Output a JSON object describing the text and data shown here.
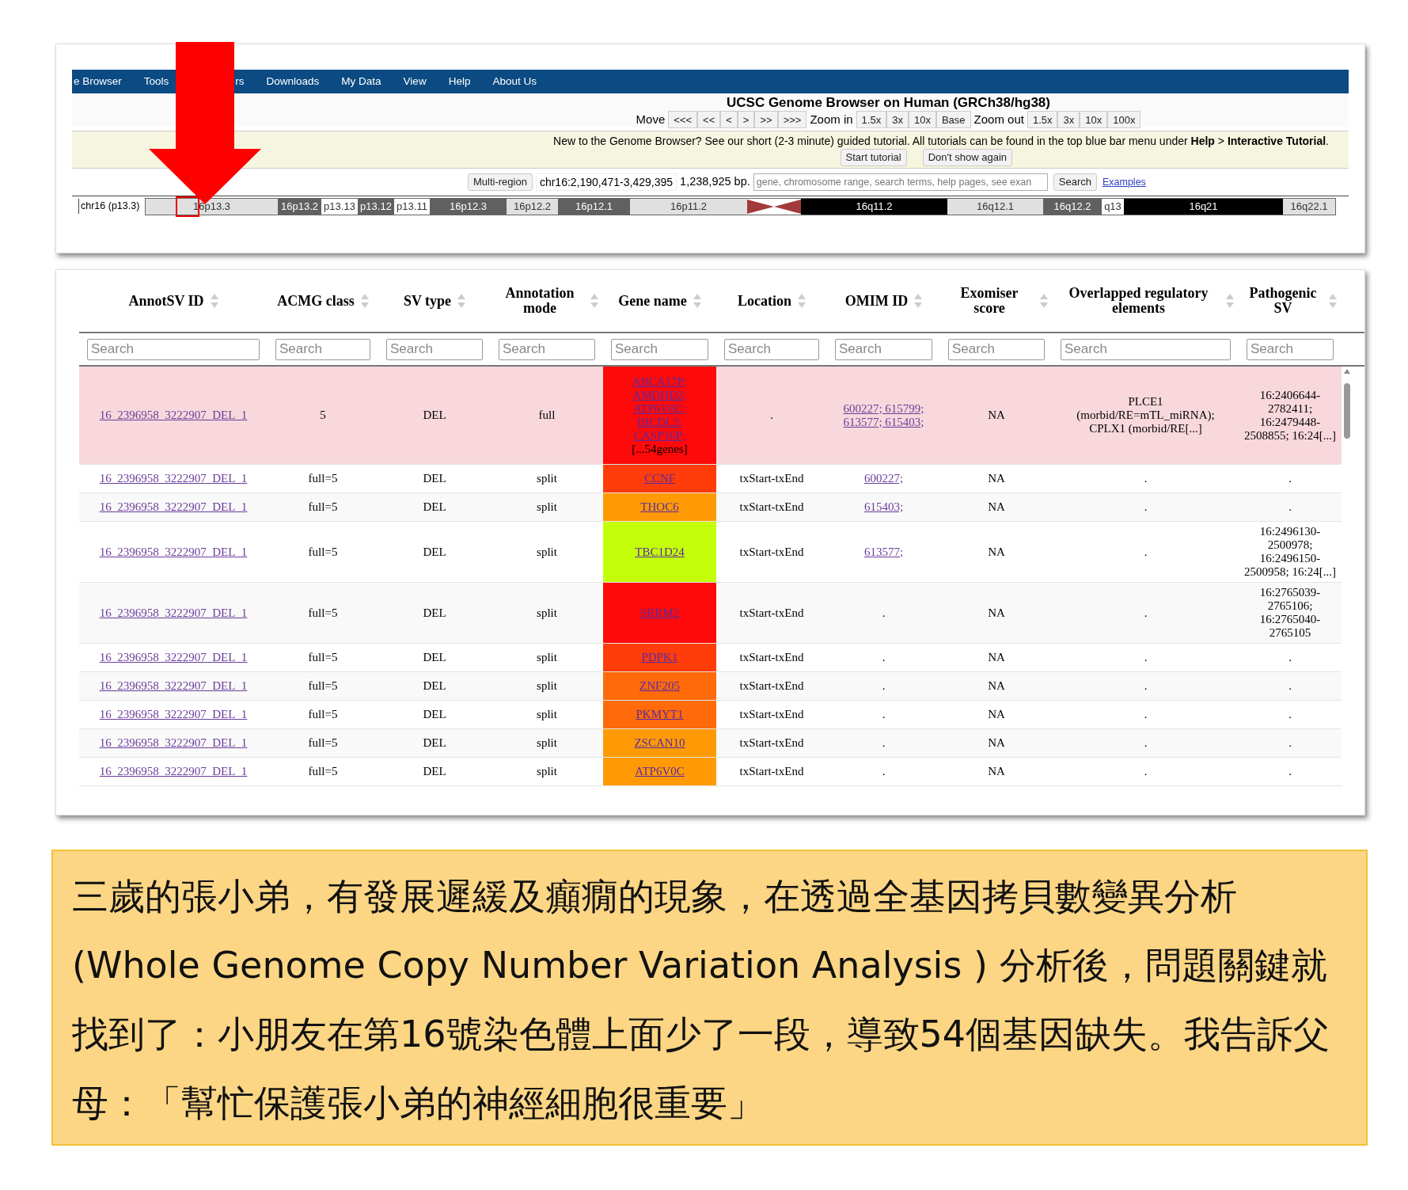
{
  "browser": {
    "nav": [
      "e Browser",
      "Tools",
      "rs",
      "Downloads",
      "My Data",
      "View",
      "Help",
      "About Us"
    ],
    "title": "UCSC Genome Browser on Human (GRCh38/hg38)",
    "move_label": "Move",
    "move_buttons": [
      "<<<",
      "<<",
      "<",
      ">",
      ">>",
      ">>>"
    ],
    "zoom_in_label": "Zoom in",
    "zoom_in_buttons": [
      "1.5x",
      "3x",
      "10x",
      "Base"
    ],
    "zoom_out_label": "Zoom out",
    "zoom_out_buttons": [
      "1.5x",
      "3x",
      "10x",
      "100x"
    ],
    "tutorial_notice": "New to the Genome Browser? See our short (2-3 minute) guided tutorial. All tutorials can be found in the top blue bar menu under **Help** > **Interactive Tutorial**.",
    "tutorial_buttons": [
      "Start tutorial",
      "Don't show again"
    ],
    "multi_region": "Multi-region",
    "position": "chr16:2,190,471-3,429,395",
    "span": "1,238,925 bp.",
    "search": {
      "placeholder": "gene, chromosome range, search terms, help pages, see exan"
    },
    "search_button": "Search",
    "examples_link": "Examples",
    "chromosome_label": "chr16 (p13.3)",
    "bands": [
      {
        "label": "16p13.3",
        "kind": "light",
        "selected": true
      },
      {
        "label": "16p13.2",
        "kind": "dark",
        "selected": false
      },
      {
        "label": "p13.13",
        "kind": "white",
        "selected": false
      },
      {
        "label": "p13.12",
        "kind": "dark",
        "selected": false
      },
      {
        "label": "p13.11",
        "kind": "white",
        "selected": false
      },
      {
        "label": "16p12.3",
        "kind": "dark",
        "selected": false
      },
      {
        "label": "16p12.2",
        "kind": "light",
        "selected": false
      },
      {
        "label": "16p12.1",
        "kind": "dark",
        "selected": false
      },
      {
        "label": "16p11.2",
        "kind": "light",
        "selected": false
      },
      {
        "kind": "centromere",
        "selected": false
      },
      {
        "label": "16q11.2",
        "kind": "black",
        "selected": false
      },
      {
        "label": "16q12.1",
        "kind": "light",
        "selected": false
      },
      {
        "label": "16q12.2",
        "kind": "dark",
        "selected": false
      },
      {
        "label": "q13",
        "kind": "white",
        "selected": false
      },
      {
        "label": "16q21",
        "kind": "black",
        "selected": false
      },
      {
        "label": "16q22.1",
        "kind": "light",
        "selected": false
      }
    ]
  },
  "table": {
    "columns": [
      {
        "label": "AnnotSV ID",
        "filter_placeholder": "Search"
      },
      {
        "label": "ACMG class",
        "filter_placeholder": "Search"
      },
      {
        "label": "SV type",
        "filter_placeholder": "Search"
      },
      {
        "label": "Annotation mode",
        "filter_placeholder": "Search"
      },
      {
        "label": "Gene name",
        "filter_placeholder": "Search"
      },
      {
        "label": "Location",
        "filter_placeholder": "Search"
      },
      {
        "label": "OMIM ID",
        "filter_placeholder": "Search"
      },
      {
        "label": "Exomiser score",
        "filter_placeholder": "Search"
      },
      {
        "label": "Overlapped regulatory elements",
        "filter_placeholder": "Search"
      },
      {
        "label": "Pathogenic SV",
        "filter_placeholder": "Search"
      }
    ],
    "rows": [
      {
        "selected": true,
        "annotsv_id": "16_2396958_3222907_DEL_1",
        "acmg_class": "5",
        "sv_type": "DEL",
        "annotation_mode": "full",
        "genes": [
          "ABCA17P;",
          "AMDHD2;",
          "ATP6V0C;",
          "BICDL2;",
          "CASP16P;"
        ],
        "gene_note": "[...54genes]",
        "color": "#fe0a0a",
        "location": ".",
        "omim": "600227; 615799; 613577; 615403;",
        "omim_linked": true,
        "exomiser": "NA",
        "regulatory": "PLCE1 (morbid/RE=mTL_miRNA); CPLX1 (morbid/RE[...]",
        "pathogenic_sv": "16:2406644-2782411; 16:2479448-2508855; 16:24[...]"
      },
      {
        "selected": false,
        "annotsv_id": "16_2396958_3222907_DEL_1",
        "acmg_class": "full=5",
        "sv_type": "DEL",
        "annotation_mode": "split",
        "genes": [
          "CCNF"
        ],
        "color": "#ff3c0a",
        "location": "txStart-txEnd",
        "omim": "600227;",
        "omim_linked": true,
        "exomiser": "NA",
        "regulatory": ".",
        "pathogenic_sv": "."
      },
      {
        "selected": false,
        "annotsv_id": "16_2396958_3222907_DEL_1",
        "acmg_class": "full=5",
        "sv_type": "DEL",
        "annotation_mode": "split",
        "genes": [
          "THOC6"
        ],
        "color": "#ff9a05",
        "location": "txStart-txEnd",
        "omim": "615403;",
        "omim_linked": true,
        "exomiser": "NA",
        "regulatory": ".",
        "pathogenic_sv": "."
      },
      {
        "selected": false,
        "annotsv_id": "16_2396958_3222907_DEL_1",
        "acmg_class": "full=5",
        "sv_type": "DEL",
        "annotation_mode": "split",
        "genes": [
          "TBC1D24"
        ],
        "color": "#c4ff0a",
        "location": "txStart-txEnd",
        "omim": "613577;",
        "omim_linked": true,
        "exomiser": "NA",
        "regulatory": ".",
        "pathogenic_sv": "16:2496130-2500978; 16:2496150-2500958; 16:24[...]"
      },
      {
        "selected": false,
        "annotsv_id": "16_2396958_3222907_DEL_1",
        "acmg_class": "full=5",
        "sv_type": "DEL",
        "annotation_mode": "split",
        "genes": [
          "SRRM2"
        ],
        "color": "#fe0a0a",
        "location": "txStart-txEnd",
        "omim": ".",
        "omim_linked": false,
        "exomiser": "NA",
        "regulatory": ".",
        "pathogenic_sv": "16:2765039-2765106; 16:2765040-2765105"
      },
      {
        "selected": false,
        "annotsv_id": "16_2396958_3222907_DEL_1",
        "acmg_class": "full=5",
        "sv_type": "DEL",
        "annotation_mode": "split",
        "genes": [
          "PDPK1"
        ],
        "color": "#ff3c0a",
        "location": "txStart-txEnd",
        "omim": ".",
        "omim_linked": false,
        "exomiser": "NA",
        "regulatory": ".",
        "pathogenic_sv": "."
      },
      {
        "selected": false,
        "annotsv_id": "16_2396958_3222907_DEL_1",
        "acmg_class": "full=5",
        "sv_type": "DEL",
        "annotation_mode": "split",
        "genes": [
          "ZNF205"
        ],
        "color": "#ff6a0a",
        "location": "txStart-txEnd",
        "omim": ".",
        "omim_linked": false,
        "exomiser": "NA",
        "regulatory": ".",
        "pathogenic_sv": "."
      },
      {
        "selected": false,
        "annotsv_id": "16_2396958_3222907_DEL_1",
        "acmg_class": "full=5",
        "sv_type": "DEL",
        "annotation_mode": "split",
        "genes": [
          "PKMYT1"
        ],
        "color": "#ff6a0a",
        "location": "txStart-txEnd",
        "omim": ".",
        "omim_linked": false,
        "exomiser": "NA",
        "regulatory": ".",
        "pathogenic_sv": "."
      },
      {
        "selected": false,
        "annotsv_id": "16_2396958_3222907_DEL_1",
        "acmg_class": "full=5",
        "sv_type": "DEL",
        "annotation_mode": "split",
        "genes": [
          "ZSCAN10"
        ],
        "color": "#ff9a05",
        "location": "txStart-txEnd",
        "omim": ".",
        "omim_linked": false,
        "exomiser": "NA",
        "regulatory": ".",
        "pathogenic_sv": "."
      },
      {
        "selected": false,
        "annotsv_id": "16_2396958_3222907_DEL_1",
        "acmg_class": "full=5",
        "sv_type": "DEL",
        "annotation_mode": "split",
        "genes": [
          "ATP6V0C"
        ],
        "color": "#ff9a05",
        "location": "txStart-txEnd",
        "omim": ".",
        "omim_linked": false,
        "exomiser": "NA",
        "regulatory": ".",
        "pathogenic_sv": "."
      }
    ]
  },
  "note": {
    "paragraph": "三歲的張小弟，有發展遲緩及癲癇的現象，在透過全基因拷貝數變異分析 (Whole Genome Copy Number Variation Analysis ) 分析後，問題關鍵就找到了：小朋友在第16號染色體上面少了一段，導致54個基因缺失。我告訴父母：「幫忙保護張小弟的神經細胞很重要」"
  }
}
